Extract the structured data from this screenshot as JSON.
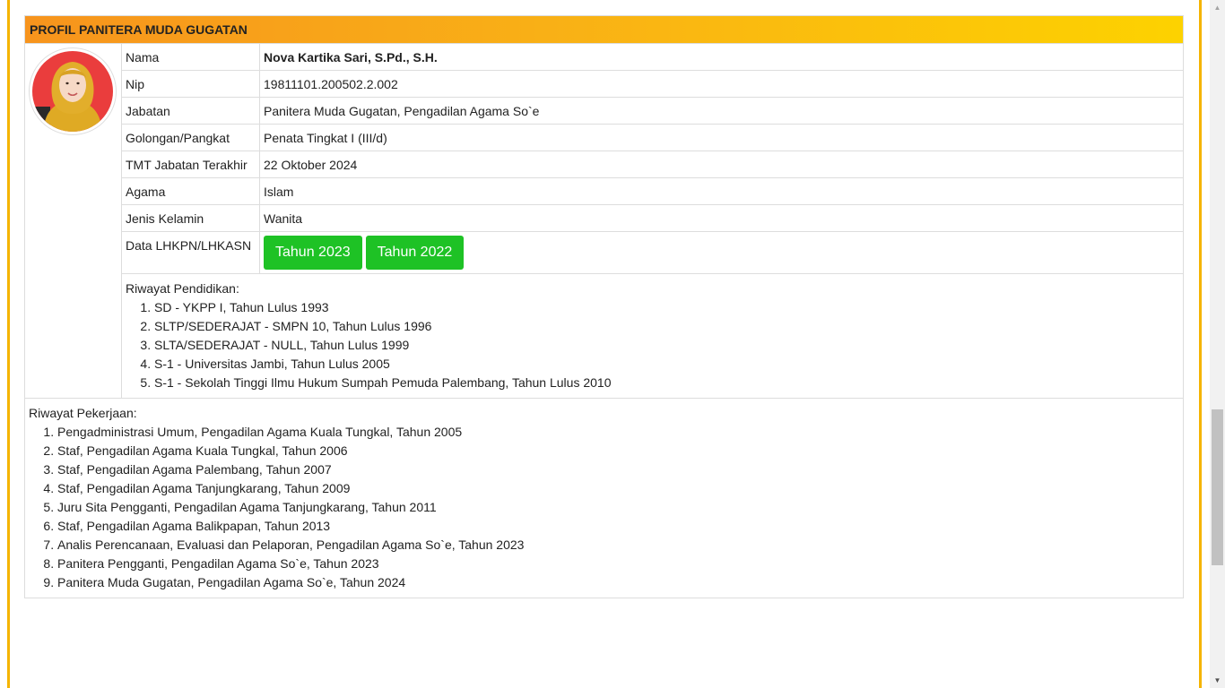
{
  "header": {
    "title": "PROFIL PANITERA MUDA GUGATAN"
  },
  "profile": {
    "fields": [
      {
        "label": "Nama",
        "value": "Nova Kartika Sari, S.Pd., S.H."
      },
      {
        "label": "Nip",
        "value": "19811101.200502.2.002"
      },
      {
        "label": "Jabatan",
        "value": "Panitera Muda Gugatan, Pengadilan Agama So`e"
      },
      {
        "label": "Golongan/Pangkat",
        "value": "Penata Tingkat I (III/d)"
      },
      {
        "label": "TMT Jabatan Terakhir",
        "value": "22 Oktober 2024"
      },
      {
        "label": "Agama",
        "value": "Islam"
      },
      {
        "label": "Jenis Kelamin",
        "value": "Wanita"
      }
    ],
    "lhkpn": {
      "label": "Data LHKPN/LHKASN",
      "buttons": [
        "Tahun 2023",
        "Tahun 2022"
      ]
    },
    "button_color": "#1ec225"
  },
  "education": {
    "title": "Riwayat Pendidikan:",
    "items": [
      "SD - YKPP I, Tahun Lulus 1993",
      "SLTP/SEDERAJAT - SMPN 10, Tahun Lulus 1996",
      "SLTA/SEDERAJAT - NULL, Tahun Lulus 1999",
      "S-1 - Universitas Jambi, Tahun Lulus 2005",
      "S-1 - Sekolah Tinggi Ilmu Hukum Sumpah Pemuda Palembang, Tahun Lulus 2010"
    ]
  },
  "work": {
    "title": "Riwayat Pekerjaan:",
    "items": [
      "Pengadministrasi Umum, Pengadilan Agama Kuala Tungkal, Tahun 2005",
      "Staf, Pengadilan Agama Kuala Tungkal, Tahun 2006",
      "Staf, Pengadilan Agama Palembang, Tahun 2007",
      "Staf, Pengadilan Agama Tanjungkarang, Tahun 2009",
      "Juru Sita Pengganti, Pengadilan Agama Tanjungkarang, Tahun 2011",
      "Staf, Pengadilan Agama Balikpapan, Tahun 2013",
      "Analis Perencanaan, Evaluasi dan Pelaporan, Pengadilan Agama So`e, Tahun 2023",
      "Panitera Pengganti, Pengadilan Agama So`e, Tahun 2023",
      "Panitera Muda Gugatan, Pengadilan Agama So`e, Tahun 2024"
    ]
  },
  "colors": {
    "accent": "#f5b400",
    "header_gradient_start": "#f7941d",
    "header_gradient_end": "#fdd200"
  },
  "icons": {
    "scroll_up": "scroll-up-arrow-icon",
    "scroll_down": "scroll-down-arrow-icon"
  }
}
